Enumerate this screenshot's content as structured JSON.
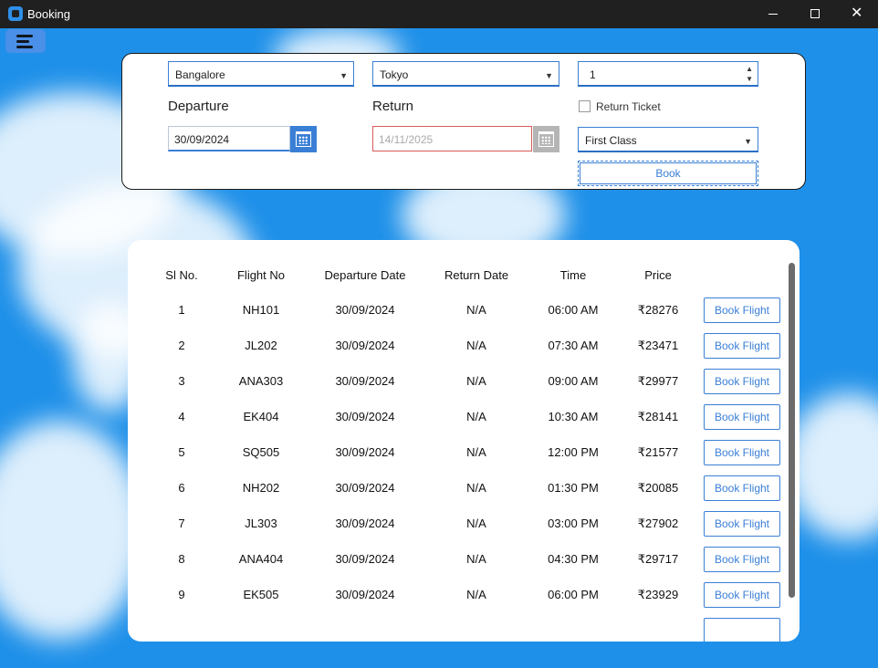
{
  "window": {
    "title": "Booking"
  },
  "form": {
    "from_city": "Bangalore",
    "to_city": "Tokyo",
    "passengers": "1",
    "departure_label": "Departure",
    "return_label": "Return",
    "departure_date": "30/09/2024",
    "return_date": "14/11/2025",
    "return_ticket_label": "Return Ticket",
    "return_ticket_checked": false,
    "class": "First Class",
    "book_label": "Book"
  },
  "table": {
    "headers": [
      "Sl No.",
      "Flight No",
      "Departure Date",
      "Return Date",
      "Time",
      "Price"
    ],
    "button_label": "Book Flight",
    "rows": [
      {
        "sl": "1",
        "flight": "NH101",
        "dep": "30/09/2024",
        "ret": "N/A",
        "time": "06:00 AM",
        "price": "₹28276"
      },
      {
        "sl": "2",
        "flight": "JL202",
        "dep": "30/09/2024",
        "ret": "N/A",
        "time": "07:30 AM",
        "price": "₹23471"
      },
      {
        "sl": "3",
        "flight": "ANA303",
        "dep": "30/09/2024",
        "ret": "N/A",
        "time": "09:00 AM",
        "price": "₹29977"
      },
      {
        "sl": "4",
        "flight": "EK404",
        "dep": "30/09/2024",
        "ret": "N/A",
        "time": "10:30 AM",
        "price": "₹28141"
      },
      {
        "sl": "5",
        "flight": "SQ505",
        "dep": "30/09/2024",
        "ret": "N/A",
        "time": "12:00 PM",
        "price": "₹21577"
      },
      {
        "sl": "6",
        "flight": "NH202",
        "dep": "30/09/2024",
        "ret": "N/A",
        "time": "01:30 PM",
        "price": "₹20085"
      },
      {
        "sl": "7",
        "flight": "JL303",
        "dep": "30/09/2024",
        "ret": "N/A",
        "time": "03:00 PM",
        "price": "₹27902"
      },
      {
        "sl": "8",
        "flight": "ANA404",
        "dep": "30/09/2024",
        "ret": "N/A",
        "time": "04:30 PM",
        "price": "₹29717"
      },
      {
        "sl": "9",
        "flight": "EK505",
        "dep": "30/09/2024",
        "ret": "N/A",
        "time": "06:00 PM",
        "price": "₹23929"
      }
    ]
  },
  "colors": {
    "accent": "#3a7fd6",
    "sky": "#1e90e9",
    "titlebar": "#202020"
  }
}
